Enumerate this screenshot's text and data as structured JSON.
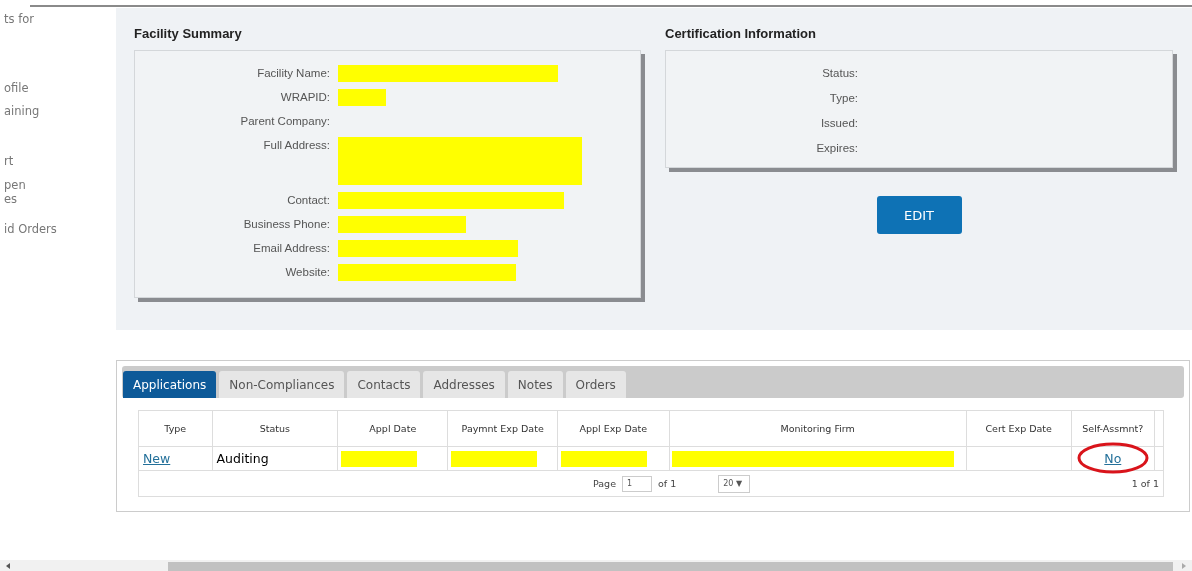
{
  "sidebar": {
    "items": [
      {
        "label": "ts for"
      },
      {
        "label": "ofile"
      },
      {
        "label": "aining"
      },
      {
        "label": "rt"
      },
      {
        "label": "pen"
      },
      {
        "label": "es"
      },
      {
        "label": "id Orders"
      }
    ]
  },
  "facility_summary": {
    "title": "Facility Summary",
    "fields": [
      {
        "label": "Facility Name:",
        "redacted": true,
        "kind": "line"
      },
      {
        "label": "WRAPID:",
        "redacted": true,
        "kind": "line"
      },
      {
        "label": "Parent Company:",
        "redacted": false,
        "kind": "line"
      },
      {
        "label": "Full Address:",
        "redacted": true,
        "kind": "block"
      },
      {
        "label": "Contact:",
        "redacted": true,
        "kind": "line"
      },
      {
        "label": "Business Phone:",
        "redacted": true,
        "kind": "line"
      },
      {
        "label": "Email Address:",
        "redacted": true,
        "kind": "line"
      },
      {
        "label": "Website:",
        "redacted": true,
        "kind": "line"
      }
    ]
  },
  "certification": {
    "title": "Certification Information",
    "fields": [
      {
        "label": "Status:"
      },
      {
        "label": "Type:"
      },
      {
        "label": "Issued:"
      },
      {
        "label": "Expires:"
      }
    ],
    "button": "EDIT"
  },
  "tabs": [
    {
      "label": "Applications",
      "selected": true
    },
    {
      "label": "Non-Compliances",
      "selected": false
    },
    {
      "label": "Contacts",
      "selected": false
    },
    {
      "label": "Addresses",
      "selected": false
    },
    {
      "label": "Notes",
      "selected": false
    },
    {
      "label": "Orders",
      "selected": false
    }
  ],
  "table": {
    "columns": [
      "Type",
      "Status",
      "Appl Date",
      "Paymnt Exp Date",
      "Appl Exp Date",
      "Monitoring Firm",
      "Cert Exp Date",
      "Self-Assmnt?"
    ],
    "rows": [
      {
        "cells": [
          {
            "kind": "link",
            "text": "New"
          },
          {
            "kind": "text",
            "text": "Auditing"
          },
          {
            "kind": "redacted"
          },
          {
            "kind": "redacted"
          },
          {
            "kind": "redacted"
          },
          {
            "kind": "redacted"
          },
          {
            "kind": "empty"
          },
          {
            "kind": "link",
            "text": "No",
            "circled": true
          }
        ]
      }
    ]
  },
  "pager": {
    "page_label": "Page",
    "page": "1",
    "of": "of 1",
    "page_size": "20 ▼",
    "records": "1 of 1"
  }
}
